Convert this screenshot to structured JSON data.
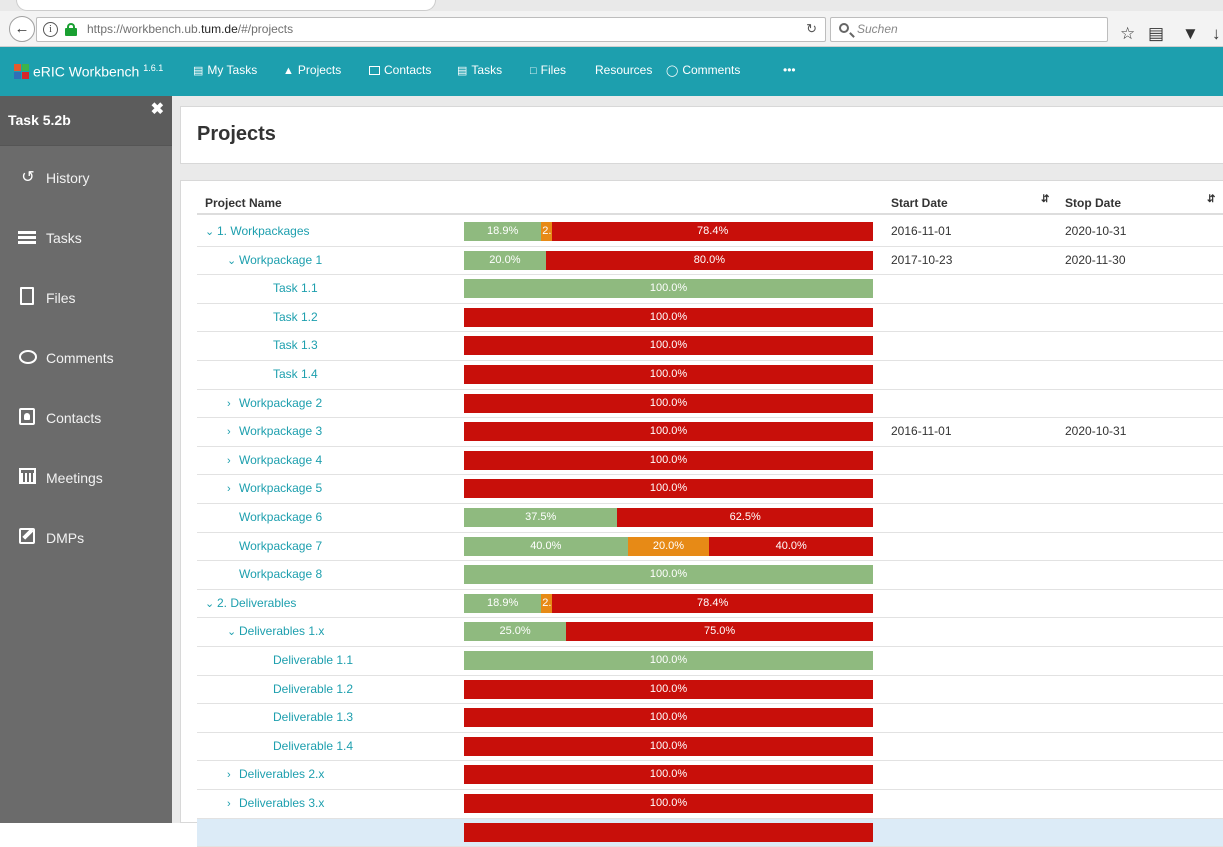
{
  "browser": {
    "url_prefix": "https://workbench.ub.",
    "url_host": "tum.de",
    "url_suffix": "/#/projects",
    "search_placeholder": "Suchen"
  },
  "navbar": {
    "brand": "eRIC Workbench",
    "version": "1.6.1",
    "items": [
      {
        "label": "My Tasks",
        "icon": "list-icon"
      },
      {
        "label": "Projects",
        "icon": "folder-icon"
      },
      {
        "label": "Contacts",
        "icon": "contact-icon"
      },
      {
        "label": "Tasks",
        "icon": "list-icon"
      },
      {
        "label": "Files",
        "icon": "file-icon"
      },
      {
        "label": "Resources",
        "icon": ""
      },
      {
        "label": "Comments",
        "icon": "comment-icon"
      },
      {
        "label": "•••",
        "icon": "more-icon"
      }
    ]
  },
  "sidebar": {
    "title": "Task 5.2b",
    "items": [
      {
        "label": "History",
        "icon": "history-icon"
      },
      {
        "label": "Tasks",
        "icon": "tasks-icon"
      },
      {
        "label": "Files",
        "icon": "file-icon"
      },
      {
        "label": "Comments",
        "icon": "comment-icon"
      },
      {
        "label": "Contacts",
        "icon": "contact-icon"
      },
      {
        "label": "Meetings",
        "icon": "calendar-icon"
      },
      {
        "label": "DMPs",
        "icon": "edit-icon"
      }
    ]
  },
  "page": {
    "title": "Projects",
    "columns": {
      "name": "Project Name",
      "start": "Start Date",
      "stop": "Stop Date"
    }
  },
  "colors": {
    "done": "#8fba7f",
    "progress": "#e78a16",
    "open": "#c80f0a",
    "accent": "#1d9fae"
  },
  "rows": [
    {
      "name": "1. Workpackages",
      "level": 0,
      "chevron": "down",
      "start": "2016-11-01",
      "stop": "2020-10-31",
      "segs": [
        {
          "c": "g",
          "v": 18.9,
          "t": "18.9%"
        },
        {
          "c": "o",
          "v": 2.7,
          "t": "2."
        },
        {
          "c": "r",
          "v": 78.4,
          "t": "78.4%"
        }
      ]
    },
    {
      "name": "Workpackage 1",
      "level": 1,
      "chevron": "down",
      "start": "2017-10-23",
      "stop": "2020-11-30",
      "segs": [
        {
          "c": "g",
          "v": 20,
          "t": "20.0%"
        },
        {
          "c": "r",
          "v": 80,
          "t": "80.0%"
        }
      ]
    },
    {
      "name": "Task 1.1",
      "level": 2,
      "chevron": "",
      "start": "",
      "stop": "",
      "segs": [
        {
          "c": "g",
          "v": 100,
          "t": "100.0%"
        }
      ]
    },
    {
      "name": "Task 1.2",
      "level": 2,
      "chevron": "",
      "start": "",
      "stop": "",
      "segs": [
        {
          "c": "r",
          "v": 100,
          "t": "100.0%"
        }
      ]
    },
    {
      "name": "Task 1.3",
      "level": 2,
      "chevron": "",
      "start": "",
      "stop": "",
      "segs": [
        {
          "c": "r",
          "v": 100,
          "t": "100.0%"
        }
      ]
    },
    {
      "name": "Task 1.4",
      "level": 2,
      "chevron": "",
      "start": "",
      "stop": "",
      "segs": [
        {
          "c": "r",
          "v": 100,
          "t": "100.0%"
        }
      ]
    },
    {
      "name": "Workpackage 2",
      "level": 1,
      "chevron": "right",
      "start": "",
      "stop": "",
      "segs": [
        {
          "c": "r",
          "v": 100,
          "t": "100.0%"
        }
      ]
    },
    {
      "name": "Workpackage 3",
      "level": 1,
      "chevron": "right",
      "start": "2016-11-01",
      "stop": "2020-10-31",
      "segs": [
        {
          "c": "r",
          "v": 100,
          "t": "100.0%"
        }
      ]
    },
    {
      "name": "Workpackage 4",
      "level": 1,
      "chevron": "right",
      "start": "",
      "stop": "",
      "segs": [
        {
          "c": "r",
          "v": 100,
          "t": "100.0%"
        }
      ]
    },
    {
      "name": "Workpackage 5",
      "level": 1,
      "chevron": "right",
      "start": "",
      "stop": "",
      "segs": [
        {
          "c": "r",
          "v": 100,
          "t": "100.0%"
        }
      ]
    },
    {
      "name": "Workpackage 6",
      "level": 1,
      "chevron": "",
      "start": "",
      "stop": "",
      "segs": [
        {
          "c": "g",
          "v": 37.5,
          "t": "37.5%"
        },
        {
          "c": "r",
          "v": 62.5,
          "t": "62.5%"
        }
      ]
    },
    {
      "name": "Workpackage 7",
      "level": 1,
      "chevron": "",
      "start": "",
      "stop": "",
      "segs": [
        {
          "c": "g",
          "v": 40,
          "t": "40.0%"
        },
        {
          "c": "o",
          "v": 20,
          "t": "20.0%"
        },
        {
          "c": "r",
          "v": 40,
          "t": "40.0%"
        }
      ]
    },
    {
      "name": "Workpackage 8",
      "level": 1,
      "chevron": "",
      "start": "",
      "stop": "",
      "segs": [
        {
          "c": "g",
          "v": 100,
          "t": "100.0%"
        }
      ]
    },
    {
      "name": "2. Deliverables",
      "level": 0,
      "chevron": "down",
      "start": "",
      "stop": "",
      "segs": [
        {
          "c": "g",
          "v": 18.9,
          "t": "18.9%"
        },
        {
          "c": "o",
          "v": 2.7,
          "t": "2."
        },
        {
          "c": "r",
          "v": 78.4,
          "t": "78.4%"
        }
      ]
    },
    {
      "name": "Deliverables 1.x",
      "level": 1,
      "chevron": "down",
      "start": "",
      "stop": "",
      "segs": [
        {
          "c": "g",
          "v": 25,
          "t": "25.0%"
        },
        {
          "c": "r",
          "v": 75,
          "t": "75.0%"
        }
      ]
    },
    {
      "name": "Deliverable 1.1",
      "level": 2,
      "chevron": "",
      "start": "",
      "stop": "",
      "segs": [
        {
          "c": "g",
          "v": 100,
          "t": "100.0%"
        }
      ]
    },
    {
      "name": "Deliverable 1.2",
      "level": 2,
      "chevron": "",
      "start": "",
      "stop": "",
      "segs": [
        {
          "c": "r",
          "v": 100,
          "t": "100.0%"
        }
      ]
    },
    {
      "name": "Deliverable 1.3",
      "level": 2,
      "chevron": "",
      "start": "",
      "stop": "",
      "segs": [
        {
          "c": "r",
          "v": 100,
          "t": "100.0%"
        }
      ]
    },
    {
      "name": "Deliverable 1.4",
      "level": 2,
      "chevron": "",
      "start": "",
      "stop": "",
      "segs": [
        {
          "c": "r",
          "v": 100,
          "t": "100.0%"
        }
      ]
    },
    {
      "name": "Deliverables 2.x",
      "level": 1,
      "chevron": "right",
      "start": "",
      "stop": "",
      "segs": [
        {
          "c": "r",
          "v": 100,
          "t": "100.0%"
        }
      ]
    },
    {
      "name": "Deliverables 3.x",
      "level": 1,
      "chevron": "right",
      "start": "",
      "stop": "",
      "segs": [
        {
          "c": "r",
          "v": 100,
          "t": "100.0%"
        }
      ]
    },
    {
      "name": "",
      "level": 1,
      "chevron": "",
      "start": "",
      "stop": "",
      "selected": true,
      "segs": [
        {
          "c": "r",
          "v": 100,
          "t": ""
        }
      ]
    }
  ]
}
